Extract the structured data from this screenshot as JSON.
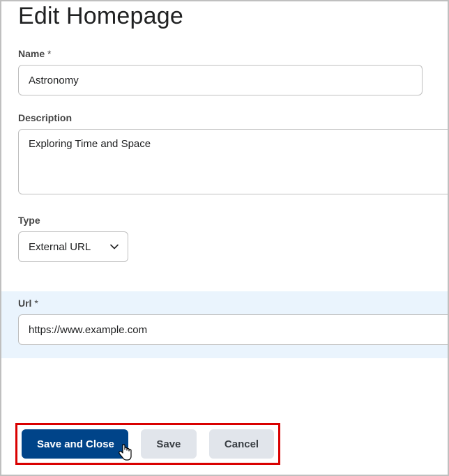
{
  "page": {
    "title": "Edit Homepage"
  },
  "fields": {
    "name": {
      "label": "Name",
      "required": "*",
      "value": "Astronomy"
    },
    "description": {
      "label": "Description",
      "value": "Exploring Time and Space"
    },
    "type": {
      "label": "Type",
      "selected": "External URL"
    },
    "url": {
      "label": "Url",
      "required": "*",
      "value": "https://www.example.com"
    }
  },
  "actions": {
    "save_close": "Save and Close",
    "save": "Save",
    "cancel": "Cancel"
  }
}
